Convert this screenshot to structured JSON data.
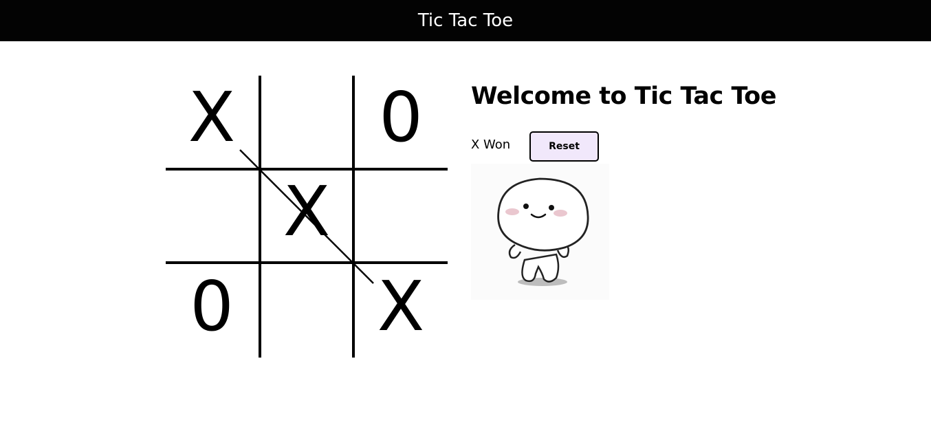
{
  "header": {
    "title": "Tic Tac Toe"
  },
  "board": {
    "cells": [
      "X",
      "",
      "0",
      "",
      "X",
      "",
      "0",
      "",
      "X"
    ],
    "winning_line": "diagonal-top-left-to-bottom-right"
  },
  "panel": {
    "heading": "Welcome to Tic Tac Toe",
    "status": "X Won",
    "reset_label": "Reset"
  },
  "celebration_image": {
    "icon": "happy-character-illustration"
  },
  "colors": {
    "navbar_bg": "#030303",
    "navbar_text": "#ffffff",
    "reset_bg": "#f1e8fb"
  }
}
